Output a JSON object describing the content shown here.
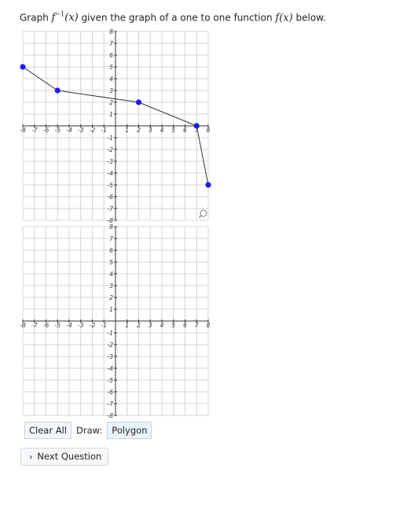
{
  "question": {
    "prefix": "Graph",
    "func_inverse": "f",
    "superscript": "−1",
    "arg": "(x)",
    "middle": "given the graph of a one to one function",
    "func": "f(x)",
    "suffix": "below."
  },
  "graph_given": {
    "x_ticks": [
      "-8",
      "-7",
      "-6",
      "-5",
      "-4",
      "-3",
      "-2",
      "-1",
      "1",
      "2",
      "3",
      "4",
      "5",
      "6",
      "7",
      "8"
    ],
    "y_ticks": [
      "8",
      "7",
      "6",
      "5",
      "4",
      "3",
      "2",
      "1",
      "-1",
      "-2",
      "-3",
      "-4",
      "-5",
      "-6",
      "-7",
      "-8"
    ],
    "points": [
      [
        -8,
        5
      ],
      [
        -5,
        3
      ],
      [
        2,
        2
      ],
      [
        7,
        0
      ],
      [
        8,
        -5
      ]
    ],
    "line_color": "#333333",
    "point_color": "#1a1aff"
  },
  "graph_answer": {
    "x_ticks": [
      "-8",
      "-7",
      "-6",
      "-5",
      "-4",
      "-3",
      "-2",
      "-1",
      "1",
      "2",
      "3",
      "4",
      "5",
      "6",
      "7",
      "8"
    ],
    "y_ticks": [
      "8",
      "7",
      "6",
      "5",
      "4",
      "3",
      "2",
      "1",
      "-1",
      "-2",
      "-3",
      "-4",
      "-5",
      "-6",
      "-7",
      "-8"
    ]
  },
  "zoom_icon": "magnifier-icon",
  "toolbar": {
    "clear_label": "Clear All",
    "draw_label": "Draw:",
    "polygon_label": "Polygon"
  },
  "next_button": {
    "icon": "chevron-right-icon",
    "label": "Next Question"
  }
}
